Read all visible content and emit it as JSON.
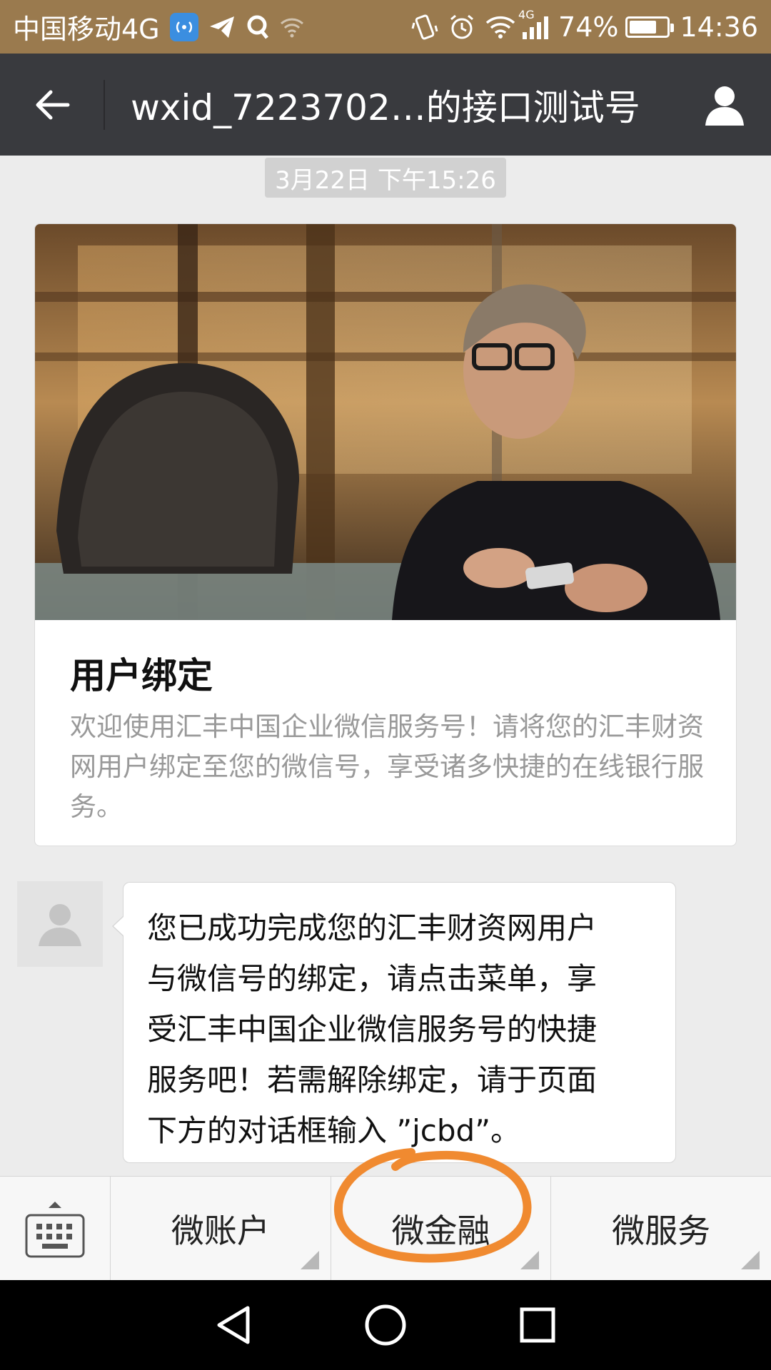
{
  "status_bar": {
    "carrier": "中国移动4G",
    "battery_percent": "74%",
    "battery_level": 0.74,
    "time": "14:36",
    "network_tag": "4G",
    "icons": [
      "hotspot-icon",
      "telegram-icon",
      "qq-icon",
      "wifi-weak-icon",
      "vibrate-icon",
      "alarm-icon",
      "wifi-icon",
      "signal-icon",
      "battery-icon"
    ]
  },
  "header": {
    "back_icon": "arrow-left-icon",
    "title": "wxid_7223702…的接口测试号",
    "profile_icon": "person-icon"
  },
  "conversation": {
    "timestamp": "3月22日 下午15:26",
    "article": {
      "title": "用户绑定",
      "description": "欢迎使用汇丰中国企业微信服务号！请将您的汇丰财资网用户绑定至您的微信号，享受诸多快捷的在线银行服务。"
    },
    "message": {
      "lines": [
        "您已成功完成您的汇丰财资网用户",
        "与微信号的绑定，请点击菜单，享",
        "受汇丰中国企业微信服务号的快捷",
        "服务吧！若需解除绑定，请于页面",
        "下方的对话框输入 ”jcbd”。"
      ]
    }
  },
  "menu": {
    "keyboard_icon": "keyboard-icon",
    "items": [
      {
        "label": "微账户"
      },
      {
        "label": "微金融"
      },
      {
        "label": "微服务"
      }
    ],
    "highlighted_item": "微金融",
    "highlight_color": "#f08a30"
  },
  "system_nav": {
    "icons": [
      "back-triangle-icon",
      "home-circle-icon",
      "recents-square-icon"
    ]
  },
  "colors": {
    "status_bar": "#9a7a4e",
    "header": "#393a3e",
    "background": "#ececec"
  }
}
